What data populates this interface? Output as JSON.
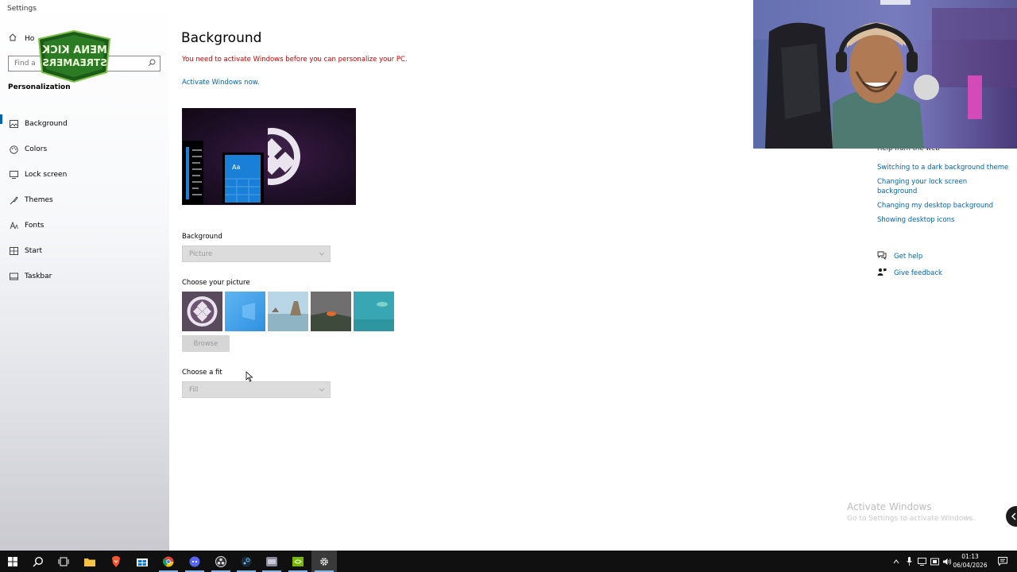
{
  "window": {
    "title": "Settings"
  },
  "sidebar": {
    "home_label": "Ho",
    "search_placeholder": "Find a",
    "section_title": "Personalization",
    "items": [
      {
        "label": "Background",
        "icon": "picture-icon",
        "active": true
      },
      {
        "label": "Colors",
        "icon": "palette-icon",
        "active": false
      },
      {
        "label": "Lock screen",
        "icon": "monitor-lock-icon",
        "active": false
      },
      {
        "label": "Themes",
        "icon": "brush-icon",
        "active": false
      },
      {
        "label": "Fonts",
        "icon": "font-icon",
        "active": false
      },
      {
        "label": "Start",
        "icon": "start-grid-icon",
        "active": false
      },
      {
        "label": "Taskbar",
        "icon": "taskbar-icon",
        "active": false
      }
    ]
  },
  "main": {
    "title": "Background",
    "warning": "You need to activate Windows before you can personalize your PC.",
    "activate_link": "Activate Windows now.",
    "preview_tile_label": "Aa",
    "background_label": "Background",
    "background_value": "Picture",
    "choose_picture_label": "Choose your picture",
    "pictures": [
      {
        "name": "current-logo",
        "color": "#5a4a5e"
      },
      {
        "name": "windows-blue",
        "color": "#3a9ee8"
      },
      {
        "name": "beach-rocks",
        "color": "#9ec6d8"
      },
      {
        "name": "lava-sky",
        "color": "#6f6f70"
      },
      {
        "name": "underwater",
        "color": "#39a6b4"
      }
    ],
    "browse_label": "Browse",
    "fit_label": "Choose a fit",
    "fit_value": "Fill"
  },
  "help": {
    "heading": "Help from the web",
    "links": [
      "Switching to a dark background theme",
      "Changing your lock screen background",
      "Changing my desktop background",
      "Showing desktop icons"
    ],
    "get_help": "Get help",
    "give_feedback": "Give feedback"
  },
  "watermark": {
    "title": "Activate Windows",
    "subtitle": "Go to Settings to activate Windows."
  },
  "overlay": {
    "logo_text": [
      "MENA KICK",
      "STREAMERS"
    ]
  },
  "taskbar": {
    "apps": [
      "start-icon",
      "search-icon",
      "task-view-icon",
      "file-explorer-icon",
      "brave-icon",
      "store-icon",
      "chrome-icon",
      "discord-icon",
      "obs-icon",
      "steam-icon",
      "app-icon",
      "nvidia-icon",
      "settings-icon"
    ],
    "time": "01:13",
    "date": "06/04/2026"
  },
  "colors": {
    "accent": "#0063b1",
    "warning": "#cc0000",
    "taskbar": "#101010"
  }
}
